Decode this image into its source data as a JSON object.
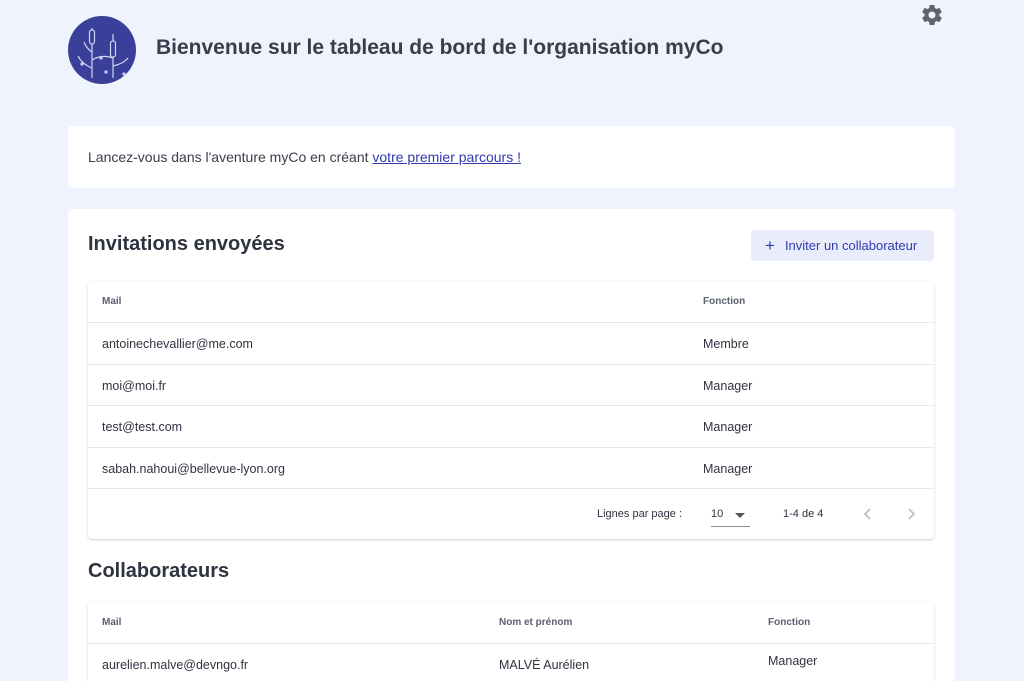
{
  "header": {
    "title": "Bienvenue sur le tableau de bord de l'organisation myCo",
    "logo_icon": "myco-logo-icon",
    "settings_icon": "gear-icon"
  },
  "banner": {
    "text": "Lancez-vous dans l'aventure myCo en créant ",
    "link": "votre premier parcours !"
  },
  "invitations": {
    "title": "Invitations envoyées",
    "invite_button": {
      "icon": "+",
      "label": "Inviter un collaborateur"
    },
    "columns": [
      "Mail",
      "Fonction"
    ],
    "rows": [
      {
        "mail": "antoinechevallier@me.com",
        "fonction": "Membre"
      },
      {
        "mail": "moi@moi.fr",
        "fonction": "Manager"
      },
      {
        "mail": "test@test.com",
        "fonction": "Manager"
      },
      {
        "mail": "sabah.nahoui@bellevue-lyon.org",
        "fonction": "Manager"
      }
    ],
    "pagination": {
      "rows_label": "Lignes par page :",
      "rows_per_page": "10",
      "range": "1-4 de 4"
    }
  },
  "collaborators": {
    "title": "Collaborateurs",
    "columns": [
      "Mail",
      "Nom et prénom",
      "Fonction"
    ],
    "rows": [
      {
        "mail": "aurelien.malve@devngo.fr",
        "name": "MALVÉ Aurélien",
        "fonction": "Manager"
      }
    ]
  },
  "colors": {
    "page_bg": "#eff3fd",
    "logo_bg": "#3a3f99",
    "accent": "#2f3ab2",
    "button_bg": "#e9edfb"
  }
}
